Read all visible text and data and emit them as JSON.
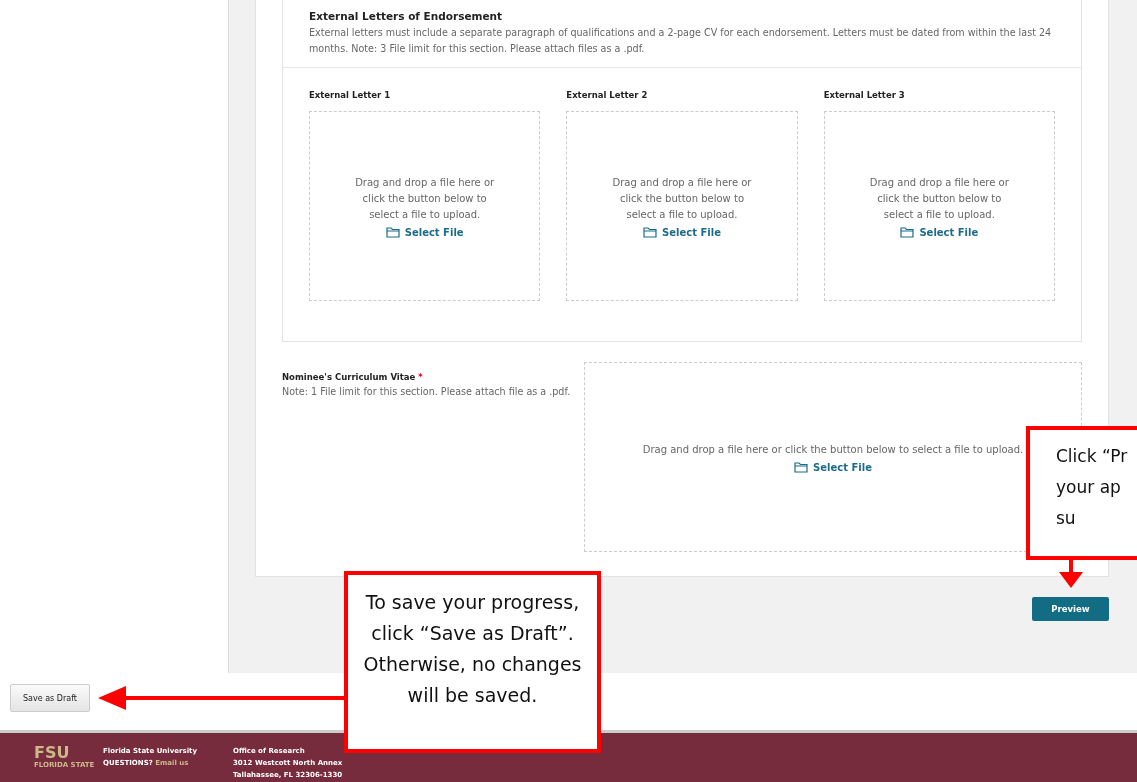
{
  "endorsements": {
    "title": "External Letters of Endorsement",
    "description": "External letters must include a separate paragraph of qualifications and a 2-page CV for each endorsement. Letters must be dated from within the last 24 months. Note: 3 File limit for this section. Please attach files as a .pdf.",
    "letters": [
      {
        "label": "External Letter 1",
        "hint": "Drag and drop a file here or click the button below to select a file to upload.",
        "button": "Select File"
      },
      {
        "label": "External Letter 2",
        "hint": "Drag and drop a file here or click the button below to select a file to upload.",
        "button": "Select File"
      },
      {
        "label": "External Letter 3",
        "hint": "Drag and drop a file here or click the button below to select a file to upload.",
        "button": "Select File"
      }
    ]
  },
  "cv": {
    "label": "Nominee's Curriculum Vitae",
    "required_mark": "*",
    "note": "Note: 1 File limit for this section. Please attach file as a .pdf.",
    "hint": "Drag and drop a file here or click the button below to select a file to upload.",
    "button": "Select File"
  },
  "preview_button": "Preview",
  "save_draft_button": "Save as Draft",
  "callouts": [
    {
      "kind": "left",
      "text": "To save your progress, click “Save as Draft”. Otherwise, no changes will be saved."
    },
    {
      "kind": "down",
      "text": "Click “Pr\nyour ap\nsu"
    }
  ],
  "footer": {
    "logo": "FSU",
    "logo_sub": "FLORIDA STATE",
    "university": "Florida State University",
    "questions": "QUESTIONS?",
    "email": "Email us",
    "office": "Office of Research",
    "address1": "3012 Westcott North Annex",
    "address2": "Tallahassee, FL 32306-1330"
  }
}
